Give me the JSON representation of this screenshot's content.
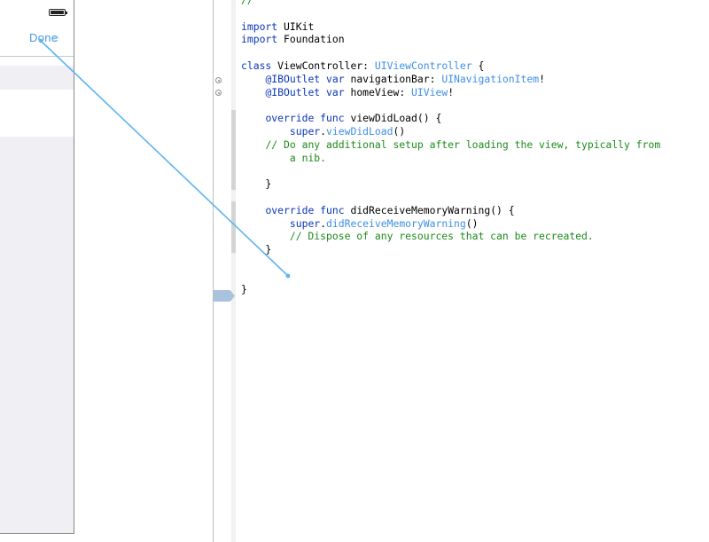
{
  "storyboard": {
    "nav_done_label": "Done",
    "nav_done_ghost": "e"
  },
  "editor": {
    "lines": [
      [
        {
          "t": "//",
          "c": "cm"
        }
      ],
      [],
      [
        {
          "t": "import",
          "c": "kw"
        },
        {
          "t": " UIKit",
          "c": "pl"
        }
      ],
      [
        {
          "t": "import",
          "c": "kw"
        },
        {
          "t": " Foundation",
          "c": "pl"
        }
      ],
      [],
      [
        {
          "t": "class",
          "c": "kw"
        },
        {
          "t": " ViewController: ",
          "c": "pl"
        },
        {
          "t": "UIViewController",
          "c": "ty"
        },
        {
          "t": " {",
          "c": "pl"
        }
      ],
      [
        {
          "t": "    ",
          "c": "pl"
        },
        {
          "t": "@IBOutlet",
          "c": "kw"
        },
        {
          "t": " ",
          "c": "pl"
        },
        {
          "t": "var",
          "c": "kw"
        },
        {
          "t": " navigationBar: ",
          "c": "pl"
        },
        {
          "t": "UINavigationItem",
          "c": "ty"
        },
        {
          "t": "!",
          "c": "pl"
        }
      ],
      [
        {
          "t": "    ",
          "c": "pl"
        },
        {
          "t": "@IBOutlet",
          "c": "kw"
        },
        {
          "t": " ",
          "c": "pl"
        },
        {
          "t": "var",
          "c": "kw"
        },
        {
          "t": " homeView: ",
          "c": "pl"
        },
        {
          "t": "UIView",
          "c": "ty"
        },
        {
          "t": "!",
          "c": "pl"
        }
      ],
      [],
      [
        {
          "t": "    ",
          "c": "pl"
        },
        {
          "t": "override",
          "c": "kw"
        },
        {
          "t": " ",
          "c": "pl"
        },
        {
          "t": "func",
          "c": "kw"
        },
        {
          "t": " viewDidLoad() {",
          "c": "pl"
        }
      ],
      [
        {
          "t": "        ",
          "c": "pl"
        },
        {
          "t": "super",
          "c": "kw"
        },
        {
          "t": ".",
          "c": "pl"
        },
        {
          "t": "viewDidLoad",
          "c": "ty"
        },
        {
          "t": "()",
          "c": "pl"
        }
      ],
      [
        {
          "t": "    ",
          "c": "pl"
        },
        {
          "t": "// Do any additional setup after loading the view, typically from",
          "c": "cm"
        }
      ],
      [
        {
          "t": "        a nib.",
          "c": "cm"
        }
      ],
      [],
      [
        {
          "t": "    }",
          "c": "pl"
        }
      ],
      [],
      [
        {
          "t": "    ",
          "c": "pl"
        },
        {
          "t": "override",
          "c": "kw"
        },
        {
          "t": " ",
          "c": "pl"
        },
        {
          "t": "func",
          "c": "kw"
        },
        {
          "t": " didReceiveMemoryWarning() {",
          "c": "pl"
        }
      ],
      [
        {
          "t": "        ",
          "c": "pl"
        },
        {
          "t": "super",
          "c": "kw"
        },
        {
          "t": ".",
          "c": "pl"
        },
        {
          "t": "didReceiveMemoryWarning",
          "c": "ty"
        },
        {
          "t": "()",
          "c": "pl"
        }
      ],
      [
        {
          "t": "        // Dispose of any resources that can be recreated.",
          "c": "cm"
        }
      ],
      [
        {
          "t": "    }",
          "c": "pl"
        }
      ],
      [],
      [],
      [
        {
          "t": "}",
          "c": "pl"
        }
      ]
    ]
  },
  "colors": {
    "keyword": "#0a35b8",
    "comment": "#1c8a1c",
    "type": "#3e8ee6",
    "connection_line": "#5fb4f0"
  }
}
